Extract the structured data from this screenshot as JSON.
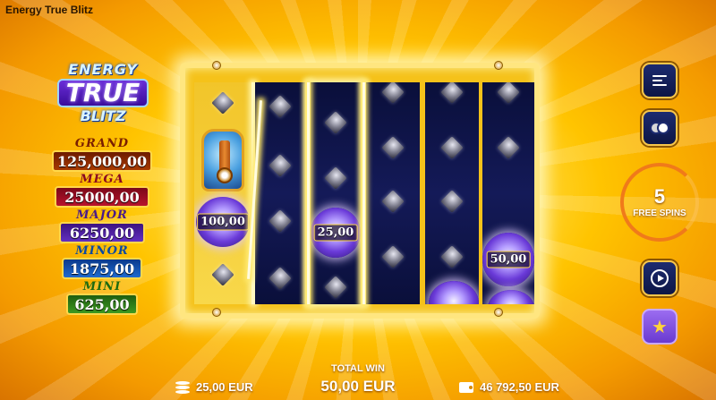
{
  "window": {
    "title": "Energy True Blitz"
  },
  "logo": {
    "line1": "ENERGY",
    "line2": "TRUE",
    "line3": "BLITZ"
  },
  "jackpots": {
    "grand": {
      "label": "GRAND",
      "value": "125,000,00"
    },
    "mega": {
      "label": "MEGA",
      "value": "25000,00"
    },
    "major": {
      "label": "MAJOR",
      "value": "6250,00"
    },
    "minor": {
      "label": "MINOR",
      "value": "1875,00"
    },
    "mini": {
      "label": "MINI",
      "value": "625,00"
    }
  },
  "reels": {
    "orbs": [
      {
        "value": "100,00"
      },
      {
        "value": "25,00"
      },
      {
        "value": "50,00"
      }
    ]
  },
  "free_spins": {
    "count": "5",
    "label": "FREE SPINS"
  },
  "bottom": {
    "total_win_label": "TOTAL WIN",
    "total_win_value": "50,00 EUR",
    "bet_value": "25,00 EUR",
    "balance_value": "46 792,50 EUR"
  },
  "icons": {
    "menu": "menu-icon",
    "coins": "coins-icon",
    "autoplay": "autoplay-icon",
    "favorite": "star-icon",
    "bet": "coin-stack-icon",
    "balance": "wallet-icon"
  },
  "colors": {
    "background": "#ffc400",
    "free_spins_ring": "#f07a1a",
    "button_fill": "#1c2b70",
    "favorite_button": "#9b6cf0"
  }
}
